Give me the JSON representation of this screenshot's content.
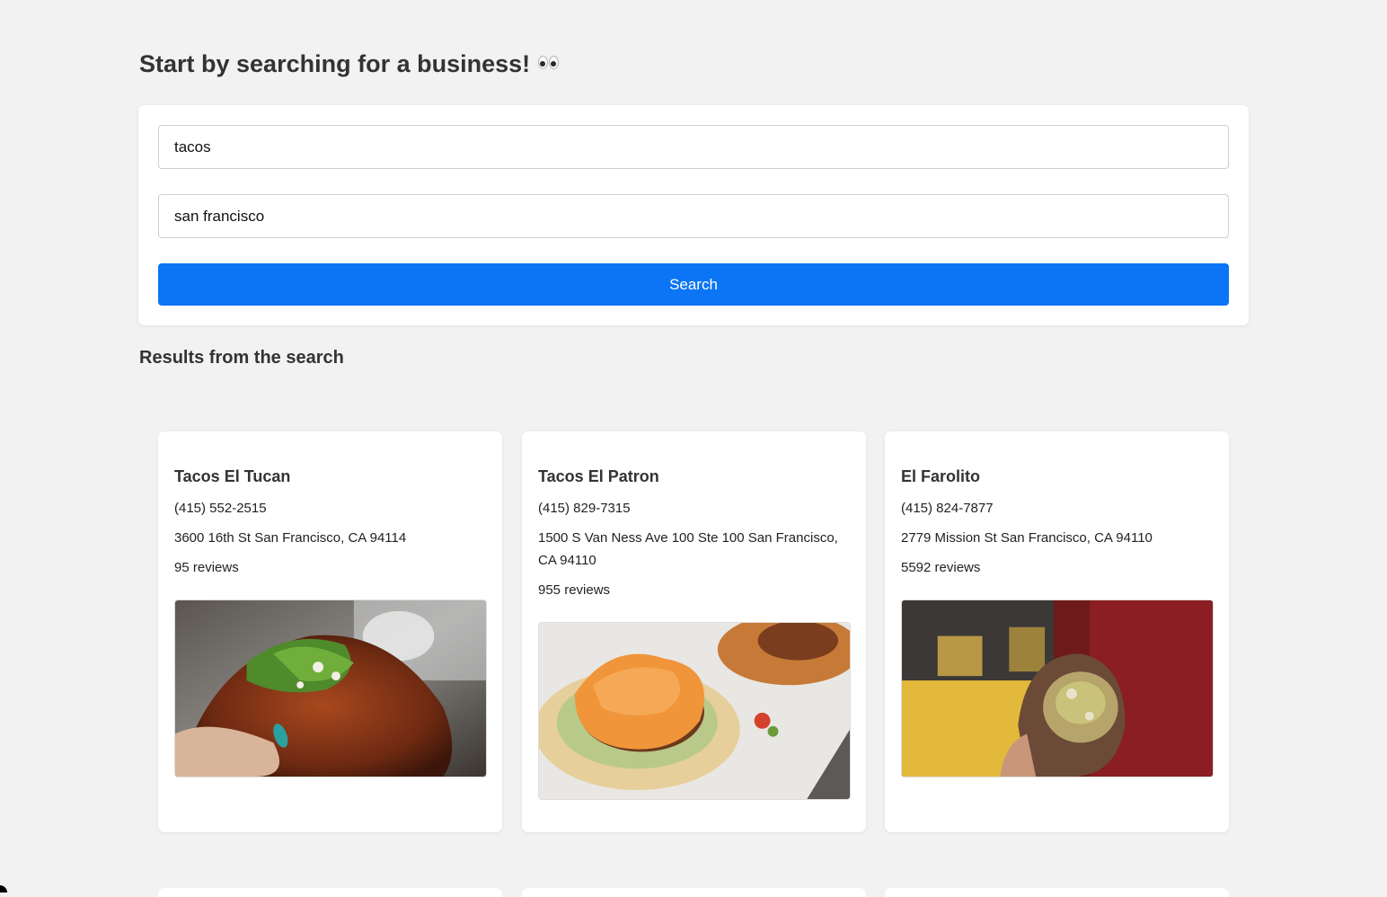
{
  "header": {
    "title": "Start by searching for a business!",
    "title_icon": "eyes-emoji"
  },
  "search": {
    "term_value": "tacos",
    "location_value": "san francisco",
    "button_label": "Search"
  },
  "results": {
    "heading": "Results from the search",
    "items": [
      {
        "name": "Tacos El Tucan",
        "phone": "(415) 552-2515",
        "address": "3600 16th St San Francisco, CA 94114",
        "reviews": "95 reviews"
      },
      {
        "name": "Tacos El Patron",
        "phone": "(415) 829-7315",
        "address": "1500 S Van Ness Ave 100 Ste 100 San Francisco, CA 94110",
        "reviews": "955 reviews"
      },
      {
        "name": "El Farolito",
        "phone": "(415) 824-7877",
        "address": "2779 Mission St San Francisco, CA 94110",
        "reviews": "5592 reviews"
      }
    ]
  },
  "colors": {
    "page_bg": "#f2f2f2",
    "accent": "#0b75f5",
    "card_bg": "#ffffff"
  }
}
